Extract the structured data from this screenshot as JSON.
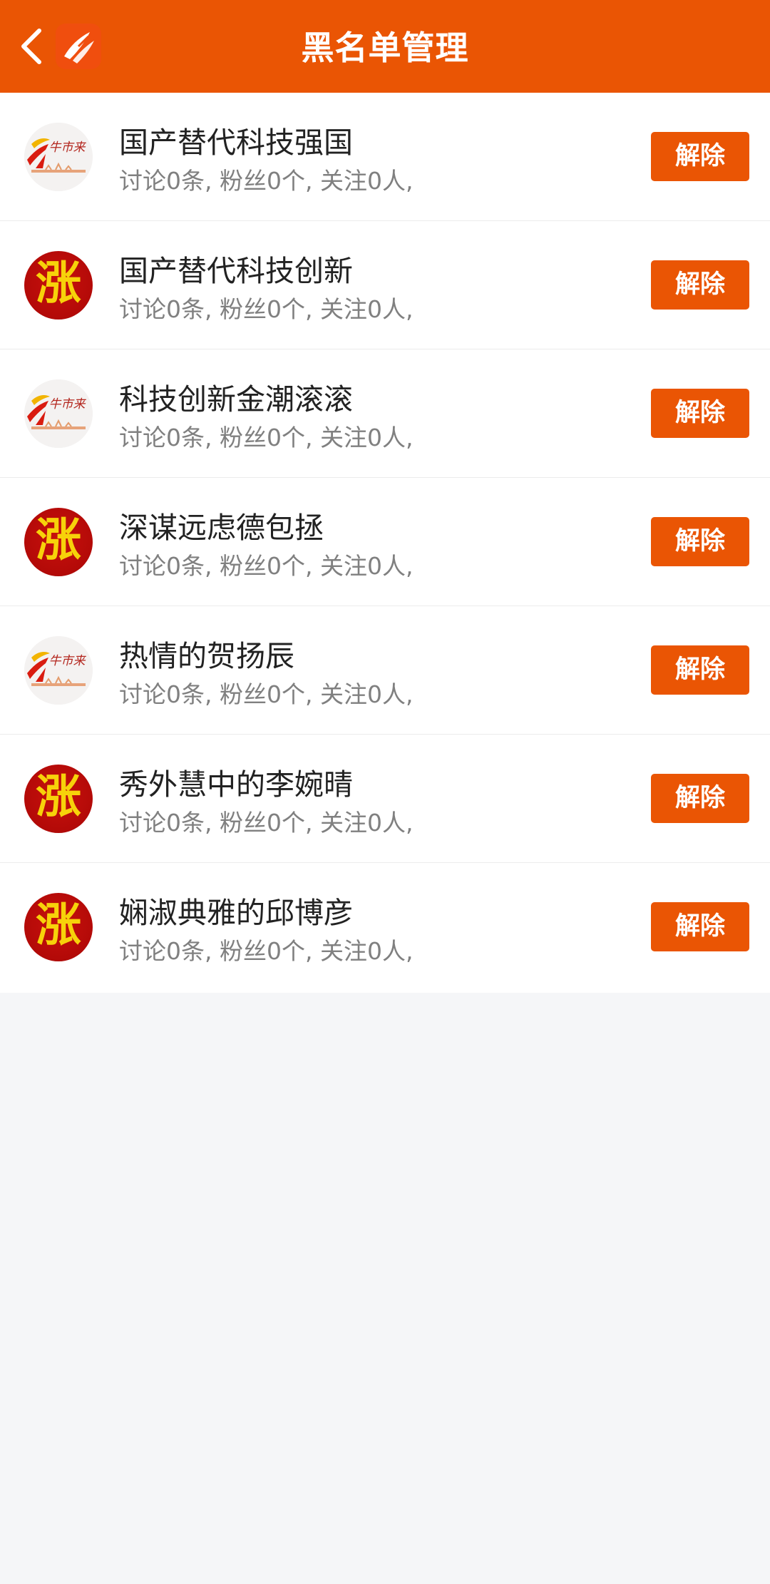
{
  "header": {
    "title": "黑名单管理",
    "back_icon": "chevron-left-icon",
    "logo_icon": "app-logo-icon",
    "color": "#ea5504"
  },
  "blacklist": [
    {
      "name": "国产替代科技强国",
      "stats": "讨论0条, 粉丝0个, 关注0人,",
      "avatar": "niu",
      "avatar_text": "牛市来",
      "button": "解除"
    },
    {
      "name": "国产替代科技创新",
      "stats": "讨论0条, 粉丝0个, 关注0人,",
      "avatar": "zhang",
      "avatar_text": "涨",
      "button": "解除"
    },
    {
      "name": "科技创新金潮滚滚",
      "stats": "讨论0条, 粉丝0个, 关注0人,",
      "avatar": "niu",
      "avatar_text": "牛市来",
      "button": "解除"
    },
    {
      "name": "深谋远虑德包拯",
      "stats": "讨论0条, 粉丝0个, 关注0人,",
      "avatar": "zhang",
      "avatar_text": "涨",
      "button": "解除"
    },
    {
      "name": "热情的贺扬辰",
      "stats": "讨论0条, 粉丝0个, 关注0人,",
      "avatar": "niu",
      "avatar_text": "牛市来",
      "button": "解除"
    },
    {
      "name": "秀外慧中的李婉晴",
      "stats": "讨论0条, 粉丝0个, 关注0人,",
      "avatar": "zhang",
      "avatar_text": "涨",
      "button": "解除"
    },
    {
      "name": "娴淑典雅的邱博彦",
      "stats": "讨论0条, 粉丝0个, 关注0人,",
      "avatar": "zhang",
      "avatar_text": "涨",
      "button": "解除"
    }
  ]
}
